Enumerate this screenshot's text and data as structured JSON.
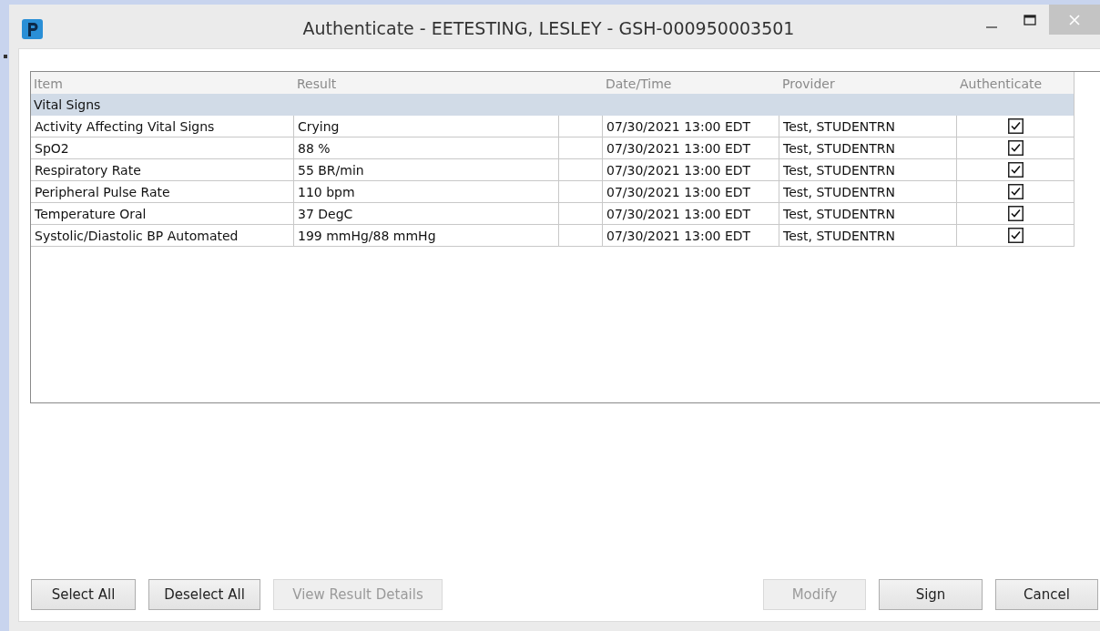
{
  "window": {
    "title": "Authenticate - EETESTING, LESLEY - GSH-000950003501"
  },
  "table": {
    "columns": [
      "Item",
      "Result",
      "Date/Time",
      "Provider",
      "Authenticate"
    ],
    "groups": [
      {
        "label": "Vital Signs",
        "rows": [
          {
            "item": "Activity Affecting Vital Signs",
            "result": "Crying",
            "date_time": "07/30/2021 13:00 EDT",
            "provider": "Test, STUDENTRN",
            "checked": true
          },
          {
            "item": "SpO2",
            "result": "88 %",
            "date_time": "07/30/2021 13:00 EDT",
            "provider": "Test, STUDENTRN",
            "checked": true
          },
          {
            "item": "Respiratory Rate",
            "result": "55 BR/min",
            "date_time": "07/30/2021 13:00 EDT",
            "provider": "Test, STUDENTRN",
            "checked": true
          },
          {
            "item": "Peripheral Pulse Rate",
            "result": "110 bpm",
            "date_time": "07/30/2021 13:00 EDT",
            "provider": "Test, STUDENTRN",
            "checked": true
          },
          {
            "item": "Temperature Oral",
            "result": "37 DegC",
            "date_time": "07/30/2021 13:00 EDT",
            "provider": "Test, STUDENTRN",
            "checked": true
          },
          {
            "item": "Systolic/Diastolic BP Automated",
            "result": "199 mmHg/88 mmHg",
            "date_time": "07/30/2021 13:00 EDT",
            "provider": "Test, STUDENTRN",
            "checked": true
          }
        ]
      }
    ]
  },
  "buttons_left": [
    {
      "label": "Select All",
      "disabled": false
    },
    {
      "label": "Deselect All",
      "disabled": false
    },
    {
      "label": "View Result Details",
      "disabled": true
    }
  ],
  "buttons_right": [
    {
      "label": "Modify",
      "disabled": true
    },
    {
      "label": "Sign",
      "disabled": false
    },
    {
      "label": "Cancel",
      "disabled": false
    }
  ]
}
